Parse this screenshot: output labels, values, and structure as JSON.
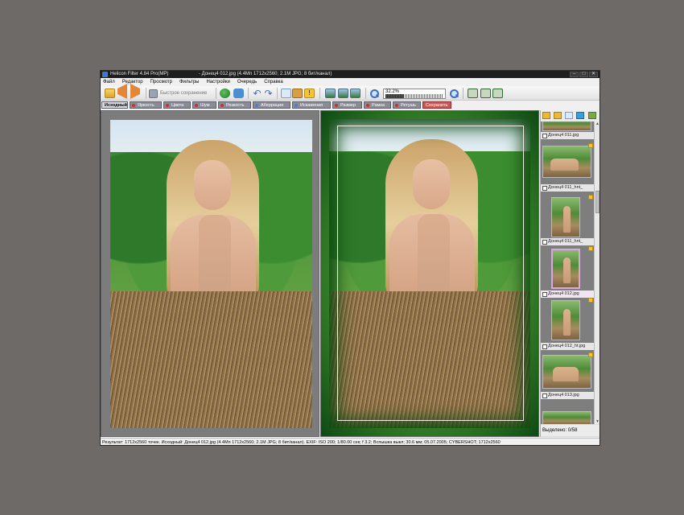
{
  "window": {
    "app_title": "Helicon Filter 4.84 Pro(MP)",
    "doc_title": "- Донец4 012.jpg (4.4Mп 1712x2560; 2.1M JPG; 8 бит/канал)",
    "min_glyph": "–",
    "max_glyph": "□",
    "close_glyph": "✕"
  },
  "menu": [
    "Файл",
    "Редактор",
    "Просмотр",
    "Фильтры",
    "Настройки",
    "Очередь",
    "Справка"
  ],
  "toolbar": {
    "quick_save_label": "Быстрое сохранение",
    "zoom_value": "32.2%",
    "zoom_level": 0.322,
    "warn_glyph": "!",
    "undo_glyph": "↶",
    "redo_glyph": "↷"
  },
  "tabs": [
    {
      "label": "Исходный",
      "kind": "active"
    },
    {
      "label": "Яркость",
      "kind": "filter"
    },
    {
      "label": "Цвета",
      "kind": "filter"
    },
    {
      "label": "Шум",
      "kind": "filter"
    },
    {
      "label": "Резкость",
      "kind": "filter"
    },
    {
      "label": "Аберрации",
      "kind": "plus"
    },
    {
      "label": "Искажения",
      "kind": "plus"
    },
    {
      "label": "Размер",
      "kind": "filter"
    },
    {
      "label": "Рамка",
      "kind": "filter"
    },
    {
      "label": "Ретушь",
      "kind": "filter"
    },
    {
      "label": "Сохранить",
      "kind": "save"
    }
  ],
  "thumbnails": [
    {
      "label": "Донец4 011.jpg",
      "selected": false
    },
    {
      "label": "Донец4 011_hnt_",
      "selected": false
    },
    {
      "label": "Донец4 011_hnt_",
      "selected": false
    },
    {
      "label": "Донец4 012.jpg",
      "selected": true
    },
    {
      "label": "Донец4 012_ht.jpg",
      "selected": false
    },
    {
      "label": "Донец4 013.jpg",
      "selected": false
    }
  ],
  "selection_text": "Выделено: 0/58",
  "status_text": "Результат: 1712x2560 точек. Исходный: Донец4 012.jpg (4.4Mп 1712x2560; 2.1M JPG; 8 бит/канал). EXIF: ISO 200; 1/80.00 сек; f 3.2; Вспышка выкл; 30.6 мм; 05.07.2005; CYBERSHOT; 1712x2560",
  "colors": {
    "accent_green": "#3f8c2c",
    "frame_border": "#0e4a14",
    "tab_active": "#d8d8e2",
    "tab_save": "#c45a5a"
  }
}
